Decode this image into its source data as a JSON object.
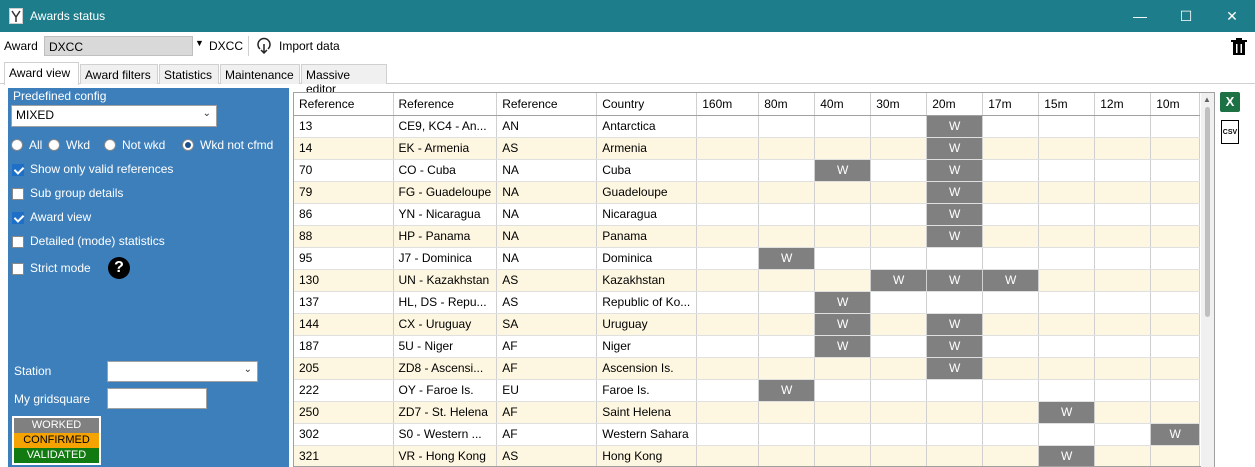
{
  "window": {
    "title": "Awards status",
    "minimize": "—",
    "maximize": "☐",
    "close": "✕"
  },
  "toolbar": {
    "award_label": "Award",
    "award_value": "DXCC",
    "award_code": "DXCC",
    "import_label": "Import data"
  },
  "tabs": [
    "Award view",
    "Award filters",
    "Statistics",
    "Maintenance",
    "Massive editor"
  ],
  "left": {
    "predefined_label": "Predefined config",
    "predefined_value": "MIXED",
    "radios": {
      "all": "All",
      "wkd": "Wkd",
      "notwkd": "Not wkd",
      "notcfmd": "Wkd not cfmd"
    },
    "checks": {
      "valid": "Show only valid references",
      "subgroup": "Sub group details",
      "award": "Award view",
      "detailed": "Detailed (mode) statistics",
      "strict": "Strict mode"
    },
    "station_label": "Station",
    "grid_label": "My gridsquare",
    "legend": {
      "worked": "WORKED",
      "confirmed": "CONFIRMED",
      "validated": "VALIDATED"
    },
    "colors": {
      "worked": "#808080",
      "confirmed": "#f5a300",
      "validated": "#117a11"
    }
  },
  "grid": {
    "headers": [
      "Reference",
      "Reference",
      "Reference",
      "Country",
      "160m",
      "80m",
      "40m",
      "30m",
      "20m",
      "17m",
      "15m",
      "12m",
      "10m"
    ],
    "rows": [
      {
        "ref": "13",
        "prefix": "CE9, KC4 - An...",
        "cont": "AN",
        "country": "Antarctica",
        "bands": [
          "",
          "",
          "",
          "",
          "W",
          "",
          "",
          "",
          ""
        ]
      },
      {
        "ref": "14",
        "prefix": "EK - Armenia",
        "cont": "AS",
        "country": "Armenia",
        "bands": [
          "",
          "",
          "",
          "",
          "W",
          "",
          "",
          "",
          ""
        ]
      },
      {
        "ref": "70",
        "prefix": "CO - Cuba",
        "cont": "NA",
        "country": "Cuba",
        "bands": [
          "",
          "",
          "W",
          "",
          "W",
          "",
          "",
          "",
          ""
        ]
      },
      {
        "ref": "79",
        "prefix": "FG - Guadeloupe",
        "cont": "NA",
        "country": "Guadeloupe",
        "bands": [
          "",
          "",
          "",
          "",
          "W",
          "",
          "",
          "",
          ""
        ]
      },
      {
        "ref": "86",
        "prefix": "YN - Nicaragua",
        "cont": "NA",
        "country": "Nicaragua",
        "bands": [
          "",
          "",
          "",
          "",
          "W",
          "",
          "",
          "",
          ""
        ]
      },
      {
        "ref": "88",
        "prefix": "HP - Panama",
        "cont": "NA",
        "country": "Panama",
        "bands": [
          "",
          "",
          "",
          "",
          "W",
          "",
          "",
          "",
          ""
        ]
      },
      {
        "ref": "95",
        "prefix": "J7 - Dominica",
        "cont": "NA",
        "country": "Dominica",
        "bands": [
          "",
          "W",
          "",
          "",
          "",
          "",
          "",
          "",
          ""
        ]
      },
      {
        "ref": "130",
        "prefix": "UN - Kazakhstan",
        "cont": "AS",
        "country": "Kazakhstan",
        "bands": [
          "",
          "",
          "",
          "W",
          "W",
          "W",
          "",
          "",
          ""
        ]
      },
      {
        "ref": "137",
        "prefix": "HL, DS - Repu...",
        "cont": "AS",
        "country": "Republic of Ko...",
        "bands": [
          "",
          "",
          "W",
          "",
          "",
          "",
          "",
          "",
          ""
        ]
      },
      {
        "ref": "144",
        "prefix": "CX - Uruguay",
        "cont": "SA",
        "country": "Uruguay",
        "bands": [
          "",
          "",
          "W",
          "",
          "W",
          "",
          "",
          "",
          ""
        ]
      },
      {
        "ref": "187",
        "prefix": "5U - Niger",
        "cont": "AF",
        "country": "Niger",
        "bands": [
          "",
          "",
          "W",
          "",
          "W",
          "",
          "",
          "",
          ""
        ]
      },
      {
        "ref": "205",
        "prefix": "ZD8 - Ascensi...",
        "cont": "AF",
        "country": "Ascension Is.",
        "bands": [
          "",
          "",
          "",
          "",
          "W",
          "",
          "",
          "",
          ""
        ]
      },
      {
        "ref": "222",
        "prefix": "OY - Faroe Is.",
        "cont": "EU",
        "country": "Faroe Is.",
        "bands": [
          "",
          "W",
          "",
          "",
          "",
          "",
          "",
          "",
          ""
        ]
      },
      {
        "ref": "250",
        "prefix": "ZD7 - St. Helena",
        "cont": "AF",
        "country": "Saint Helena",
        "bands": [
          "",
          "",
          "",
          "",
          "",
          "",
          "W",
          "",
          ""
        ]
      },
      {
        "ref": "302",
        "prefix": "S0 - Western ...",
        "cont": "AF",
        "country": "Western Sahara",
        "bands": [
          "",
          "",
          "",
          "",
          "",
          "",
          "",
          "",
          "W"
        ]
      },
      {
        "ref": "321",
        "prefix": "VR - Hong Kong",
        "cont": "AS",
        "country": "Hong Kong",
        "bands": [
          "",
          "",
          "",
          "",
          "",
          "",
          "W",
          "",
          ""
        ]
      }
    ]
  },
  "side": {
    "excel_letter": "X",
    "csv_label": "CSV"
  }
}
